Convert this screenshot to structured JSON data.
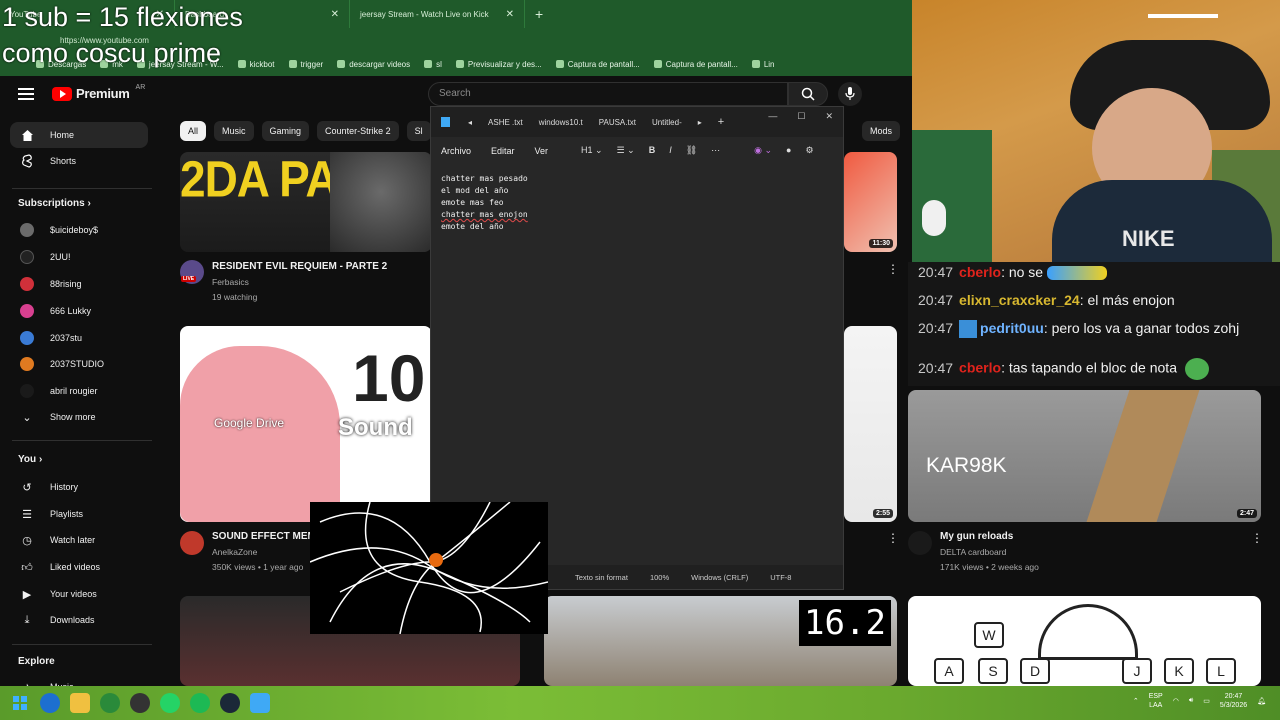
{
  "browser": {
    "tabs": [
      {
        "label": "YouTube"
      },
      {
        "label": "Dashboard"
      },
      {
        "label": "jeersay Stream - Watch Live on Kick"
      }
    ],
    "url": "https://www.youtube.com",
    "bookmarks": [
      "Descargas",
      "mk",
      "jeersay Stream - W...",
      "kickbot",
      "trigger",
      "descargar videos",
      "sl",
      "Previsualizar y des...",
      "Captura de pantall...",
      "Captura de pantall...",
      "Lin"
    ]
  },
  "overlay": {
    "line1": "1 sub = 15 flexiones",
    "line2": "como coscu prime"
  },
  "youtube": {
    "logo_text": "Premium",
    "logo_region": "AR",
    "search_placeholder": "Search",
    "chips": [
      "All",
      "Music",
      "Gaming",
      "Counter-Strike 2",
      "Sl"
    ],
    "chip_mods": "Mods",
    "sidebar": {
      "home": "Home",
      "shorts": "Shorts",
      "subscriptions_heading": "Subscriptions",
      "subscriptions": [
        "$uicideboy$",
        "2UU!",
        "88rising",
        "666 Lukky",
        "2037stu",
        "2037STUDIO",
        "abril rougier"
      ],
      "show_more": "Show more",
      "you_heading": "You",
      "you_items": [
        "History",
        "Playlists",
        "Watch later",
        "Liked videos",
        "Your videos",
        "Downloads"
      ],
      "explore_heading": "Explore",
      "explore_items": [
        "Music"
      ]
    },
    "videos": [
      {
        "title": "RESIDENT EVIL REQUIEM - PARTE 2",
        "channel": "Ferbasics",
        "meta": "19 watching",
        "badge": "LIVE",
        "thumb_text": "2DA PARTE"
      },
      {
        "title": "SOUND EFFECT MEME",
        "channel": "AnelkaZone",
        "meta": "350K views • 1 year ago",
        "thumb_text_big": "10",
        "thumb_text_sub": "Sound",
        "thumb_overlay": "Google Drive"
      },
      {
        "title": "My gun reloads",
        "channel": "DELTA cardboard",
        "meta": "171K views • 2 weeks ago",
        "duration": "2:47",
        "thumb_text": "KAR98K"
      },
      {
        "duration": "11:30"
      },
      {
        "duration": "2:55"
      },
      {
        "thumb_text": "16.2"
      },
      {
        "keys_top": [
          "W"
        ],
        "keys_bottom": [
          "A",
          "S",
          "D",
          "J",
          "K",
          "L"
        ]
      }
    ]
  },
  "notepad": {
    "tabs": [
      "ASHE .txt",
      "windows10.t",
      "PAUSA.txt",
      "Untitled-"
    ],
    "menus": [
      "Archivo",
      "Editar",
      "Ver"
    ],
    "heading_tool": "H1",
    "lines": [
      "chatter mas pesado",
      "el mod del año",
      "emote mas feo",
      "chatter mas enojon",
      "emote del año"
    ],
    "status": [
      "Texto sin format",
      "100%",
      "Windows (CRLF)",
      "UTF-8"
    ]
  },
  "webcam": {
    "cap_text": "NIKE"
  },
  "chat": [
    {
      "time": "20:47",
      "user": "cberlo",
      "message": "no se"
    },
    {
      "time": "20:47",
      "user": "elixn_craxcker_24",
      "message": "el más enojon"
    },
    {
      "time": "20:47",
      "user": "pedrit0uu",
      "message": "pero los va a ganar todos zohj"
    },
    {
      "time": "20:47",
      "user": "cberlo",
      "message": "tas tapando el bloc de nota"
    }
  ],
  "taskbar": {
    "lang": "ESP",
    "lang_sub": "LAA",
    "time": "20:47",
    "date": "5/3/2026"
  }
}
